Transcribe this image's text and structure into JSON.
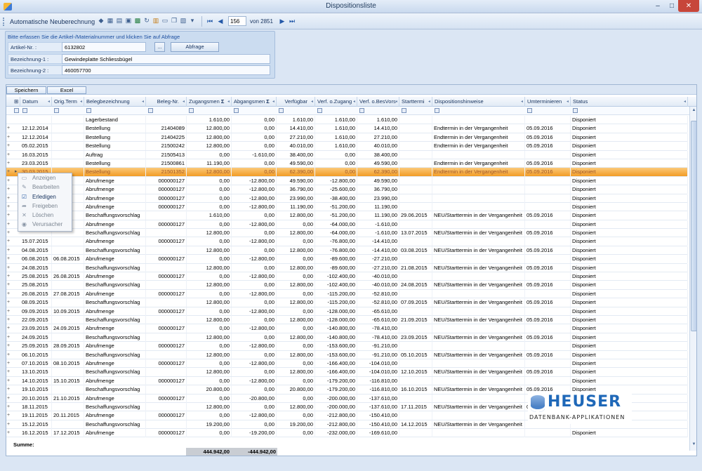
{
  "window": {
    "title": "Dispositionsliste",
    "min": "–",
    "max": "□",
    "close": "✕"
  },
  "toolbar": {
    "label": "Automatische Neuberechnung",
    "icons": [
      "eraser-icon",
      "table-icon",
      "export-icon",
      "save-icon",
      "excel-icon",
      "refresh-icon",
      "filter-icon",
      "print-icon",
      "copy-icon",
      "layout-icon",
      "dropdown-icon"
    ],
    "nav": {
      "current": "156",
      "of_text": "von 2851"
    }
  },
  "form": {
    "hint": "Bitte erfassen Sie die Artikel-/Materialnummer und klicken Sie auf Abfrage",
    "artikel_label": "Artikel-Nr. :",
    "artikel_value": "6132802",
    "browse": "...",
    "abfrage": "Abfrage",
    "bez1_label": "Bezeichnung-1 :",
    "bez1_value": "Gewindeplatte Schliessbügel",
    "bez2_label": "Bezeichnung-2 :",
    "bez2_value": "460057700"
  },
  "grid": {
    "save_label": "Speichern",
    "excel_label": "Excel",
    "columns": [
      "Datum",
      "Orig.Term",
      "Belegbezeichnung",
      "Beleg-Nr.",
      "Zugangsmen",
      "Abgangsmen",
      "Verfügbar",
      "Verf. o.Zugang",
      "Verf. o.BesVors",
      "Starttermi",
      "Dispositionshinweise",
      "Umterminieren",
      "Status"
    ],
    "sum_symbols": [
      "Σ",
      "Σ"
    ],
    "rows": [
      [
        "",
        "",
        "Lagerbestand",
        "",
        "1.610,00",
        "0,00",
        "1.610,00",
        "1.610,00",
        "1.610,00",
        "",
        "",
        "",
        "Disponiert"
      ],
      [
        "12.12.2014",
        "",
        "Bestellung",
        "21404089",
        "12.800,00",
        "0,00",
        "14.410,00",
        "1.610,00",
        "14.410,00",
        "",
        "Endtermin in der Vergangenheit",
        "05.09.2016",
        "Disponiert"
      ],
      [
        "12.12.2014",
        "",
        "Bestellung",
        "21404225",
        "12.800,00",
        "0,00",
        "27.210,00",
        "1.610,00",
        "27.210,00",
        "",
        "Endtermin in der Vergangenheit",
        "05.09.2016",
        "Disponiert"
      ],
      [
        "05.02.2015",
        "",
        "Bestellung",
        "21500242",
        "12.800,00",
        "0,00",
        "40.010,00",
        "1.610,00",
        "40.010,00",
        "",
        "Endtermin in der Vergangenheit",
        "05.09.2016",
        "Disponiert"
      ],
      [
        "16.03.2015",
        "",
        "Auftrag",
        "21505413",
        "0,00",
        "-1.610,00",
        "38.400,00",
        "0,00",
        "38.400,00",
        "",
        "",
        "",
        "Disponiert"
      ],
      [
        "23.03.2015",
        "",
        "Bestellung",
        "21500861",
        "11.190,00",
        "0,00",
        "49.590,00",
        "0,00",
        "49.590,00",
        "",
        "Endtermin in der Vergangenheit",
        "05.09.2016",
        "Disponiert"
      ],
      [
        "30.03.2015",
        "",
        "Bestellung",
        "21501352",
        "12.800,00",
        "0,00",
        "62.390,00",
        "0,00",
        "62.390,00",
        "",
        "Endtermin in der Vergangenheit",
        "05.09.2016",
        "Disponiert"
      ],
      [
        "",
        "",
        "Abrufmenge",
        "000000127",
        "0,00",
        "-12.800,00",
        "49.590,00",
        "-12.800,00",
        "49.590,00",
        "",
        "",
        "",
        "Disponiert"
      ],
      [
        "",
        "",
        "Abrufmenge",
        "000000127",
        "0,00",
        "-12.800,00",
        "36.790,00",
        "-25.600,00",
        "36.790,00",
        "",
        "",
        "",
        "Disponiert"
      ],
      [
        "",
        "",
        "Abrufmenge",
        "000000127",
        "0,00",
        "-12.800,00",
        "23.990,00",
        "-38.400,00",
        "23.990,00",
        "",
        "",
        "",
        "Disponiert"
      ],
      [
        "",
        "",
        "Abrufmenge",
        "000000127",
        "0,00",
        "-12.800,00",
        "11.190,00",
        "-51.200,00",
        "11.190,00",
        "",
        "",
        "",
        "Disponiert"
      ],
      [
        "",
        "",
        "Beschaffungsvorschlag",
        "",
        "1.610,00",
        "0,00",
        "12.800,00",
        "-51.200,00",
        "11.190,00",
        "29.06.2015",
        "NEU/Starttermin in der Vergangenheit",
        "05.09.2016",
        "Disponiert"
      ],
      [
        "",
        "",
        "Abrufmenge",
        "000000127",
        "0,00",
        "-12.800,00",
        "0,00",
        "-64.000,00",
        "-1.610,00",
        "",
        "",
        "",
        "Disponiert"
      ],
      [
        "",
        "",
        "Beschaffungsvorschlag",
        "",
        "12.800,00",
        "0,00",
        "12.800,00",
        "-64.000,00",
        "-1.610,00",
        "13.07.2015",
        "NEU/Starttermin in der Vergangenheit",
        "05.09.2016",
        "Disponiert"
      ],
      [
        "15.07.2015",
        "",
        "Abrufmenge",
        "000000127",
        "0,00",
        "-12.800,00",
        "0,00",
        "-76.800,00",
        "-14.410,00",
        "",
        "",
        "",
        "Disponiert"
      ],
      [
        "04.08.2015",
        "",
        "Beschaffungsvorschlag",
        "",
        "12.800,00",
        "0,00",
        "12.800,00",
        "-76.800,00",
        "-14.410,00",
        "03.08.2015",
        "NEU/Starttermin in der Vergangenheit",
        "05.09.2016",
        "Disponiert"
      ],
      [
        "06.08.2015",
        "06.08.2015",
        "Abrufmenge",
        "000000127",
        "0,00",
        "-12.800,00",
        "0,00",
        "-89.600,00",
        "-27.210,00",
        "",
        "",
        "",
        "Disponiert"
      ],
      [
        "24.08.2015",
        "",
        "Beschaffungsvorschlag",
        "",
        "12.800,00",
        "0,00",
        "12.800,00",
        "-89.600,00",
        "-27.210,00",
        "21.08.2015",
        "NEU/Starttermin in der Vergangenheit",
        "05.09.2016",
        "Disponiert"
      ],
      [
        "25.08.2015",
        "26.08.2015",
        "Abrufmenge",
        "000000127",
        "0,00",
        "-12.800,00",
        "0,00",
        "-102.400,00",
        "-40.010,00",
        "",
        "",
        "",
        "Disponiert"
      ],
      [
        "25.08.2015",
        "",
        "Beschaffungsvorschlag",
        "",
        "12.800,00",
        "0,00",
        "12.800,00",
        "-102.400,00",
        "-40.010,00",
        "24.08.2015",
        "NEU/Starttermin in der Vergangenheit",
        "05.09.2016",
        "Disponiert"
      ],
      [
        "26.08.2015",
        "27.08.2015",
        "Abrufmenge",
        "000000127",
        "0,00",
        "-12.800,00",
        "0,00",
        "-115.200,00",
        "-52.810,00",
        "",
        "",
        "",
        "Disponiert"
      ],
      [
        "08.09.2015",
        "",
        "Beschaffungsvorschlag",
        "",
        "12.800,00",
        "0,00",
        "12.800,00",
        "-115.200,00",
        "-52.810,00",
        "07.09.2015",
        "NEU/Starttermin in der Vergangenheit",
        "05.09.2016",
        "Disponiert"
      ],
      [
        "09.09.2015",
        "10.09.2015",
        "Abrufmenge",
        "000000127",
        "0,00",
        "-12.800,00",
        "0,00",
        "-128.000,00",
        "-65.610,00",
        "",
        "",
        "",
        "Disponiert"
      ],
      [
        "22.09.2015",
        "",
        "Beschaffungsvorschlag",
        "",
        "12.800,00",
        "0,00",
        "12.800,00",
        "-128.000,00",
        "-65.610,00",
        "21.09.2015",
        "NEU/Starttermin in der Vergangenheit",
        "05.09.2016",
        "Disponiert"
      ],
      [
        "23.09.2015",
        "24.09.2015",
        "Abrufmenge",
        "000000127",
        "0,00",
        "-12.800,00",
        "0,00",
        "-140.800,00",
        "-78.410,00",
        "",
        "",
        "",
        "Disponiert"
      ],
      [
        "24.09.2015",
        "",
        "Beschaffungsvorschlag",
        "",
        "12.800,00",
        "0,00",
        "12.800,00",
        "-140.800,00",
        "-78.410,00",
        "23.09.2015",
        "NEU/Starttermin in der Vergangenheit",
        "05.09.2016",
        "Disponiert"
      ],
      [
        "25.09.2015",
        "28.09.2015",
        "Abrufmenge",
        "000000127",
        "0,00",
        "-12.800,00",
        "0,00",
        "-153.600,00",
        "-91.210,00",
        "",
        "",
        "",
        "Disponiert"
      ],
      [
        "06.10.2015",
        "",
        "Beschaffungsvorschlag",
        "",
        "12.800,00",
        "0,00",
        "12.800,00",
        "-153.600,00",
        "-91.210,00",
        "05.10.2015",
        "NEU/Starttermin in der Vergangenheit",
        "05.09.2016",
        "Disponiert"
      ],
      [
        "07.10.2015",
        "08.10.2015",
        "Abrufmenge",
        "000000127",
        "0,00",
        "-12.800,00",
        "0,00",
        "-166.400,00",
        "-104.010,00",
        "",
        "",
        "",
        "Disponiert"
      ],
      [
        "13.10.2015",
        "",
        "Beschaffungsvorschlag",
        "",
        "12.800,00",
        "0,00",
        "12.800,00",
        "-166.400,00",
        "-104.010,00",
        "12.10.2015",
        "NEU/Starttermin in der Vergangenheit",
        "05.09.2016",
        "Disponiert"
      ],
      [
        "14.10.2015",
        "15.10.2015",
        "Abrufmenge",
        "000000127",
        "0,00",
        "-12.800,00",
        "0,00",
        "-179.200,00",
        "-116.810,00",
        "",
        "",
        "",
        "Disponiert"
      ],
      [
        "19.10.2015",
        "",
        "Beschaffungsvorschlag",
        "",
        "20.800,00",
        "0,00",
        "20.800,00",
        "-179.200,00",
        "-116.810,00",
        "16.10.2015",
        "NEU/Starttermin in der Vergangenheit",
        "05.09.2016",
        "Disponiert"
      ],
      [
        "20.10.2015",
        "21.10.2015",
        "Abrufmenge",
        "000000127",
        "0,00",
        "-20.800,00",
        "0,00",
        "-200.000,00",
        "-137.610,00",
        "",
        "",
        "",
        ""
      ],
      [
        "18.11.2015",
        "",
        "Beschaffungsvorschlag",
        "",
        "12.800,00",
        "0,00",
        "12.800,00",
        "-200.000,00",
        "-137.610,00",
        "17.11.2015",
        "NEU/Starttermin in der Vergangenheit",
        "05.09.2016",
        ""
      ],
      [
        "19.11.2015",
        "20.11.2015",
        "Abrufmenge",
        "000000127",
        "0,00",
        "-12.800,00",
        "0,00",
        "-212.800,00",
        "-150.410,00",
        "",
        "",
        "",
        ""
      ],
      [
        "15.12.2015",
        "",
        "Beschaffungsvorschlag",
        "",
        "19.200,00",
        "0,00",
        "19.200,00",
        "-212.800,00",
        "-150.410,00",
        "14.12.2015",
        "NEU/Starttermin in der Vergangenheit",
        "",
        ""
      ],
      [
        "16.12.2015",
        "17.12.2015",
        "Abrufmenge",
        "000000127",
        "0,00",
        "-19.200,00",
        "0,00",
        "-232.000,00",
        "-169.610,00",
        "",
        "",
        "",
        "Disponiert"
      ]
    ],
    "selected_row": 6,
    "sum_label": "Summe:",
    "sum_zugang": "444.942,00",
    "sum_abgang": "-444.942,00"
  },
  "context_menu": [
    {
      "label": "Anzeigen",
      "icon": "view-icon",
      "enabled": false
    },
    {
      "label": "Bearbeiten",
      "icon": "edit-icon",
      "enabled": false
    },
    {
      "label": "Erledigen",
      "icon": "check-icon",
      "enabled": true
    },
    {
      "label": "Freigeben",
      "icon": "release-icon",
      "enabled": false
    },
    {
      "label": "Löschen",
      "icon": "delete-icon",
      "enabled": false
    },
    {
      "label": "Verursacher",
      "icon": "origin-icon",
      "enabled": false
    }
  ],
  "logo": {
    "word": "HEUSER",
    "sub": "DATENBANK-APPLIKATIONEN"
  },
  "colors": {
    "accent": "#1f68b8",
    "selection": "#f29c25",
    "close": "#c7463a"
  }
}
